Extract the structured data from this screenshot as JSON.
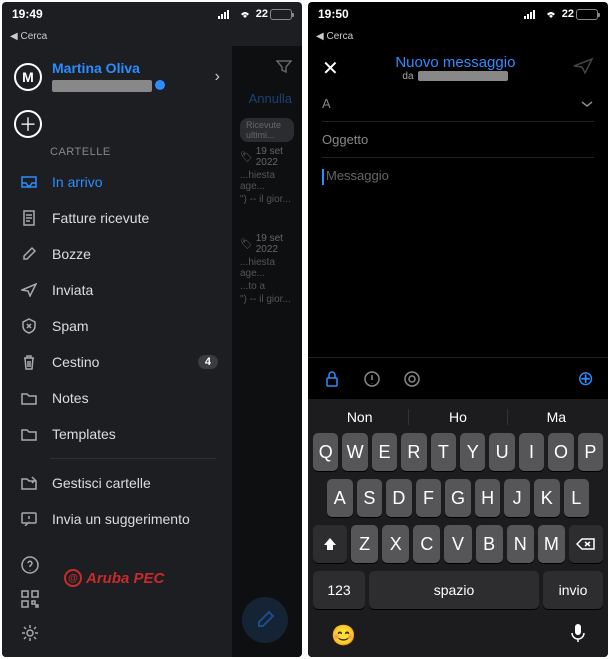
{
  "left": {
    "status": {
      "time": "19:49",
      "search": "Cerca",
      "battery_pct": "22",
      "battery_fill": 22
    },
    "user": {
      "initial": "M",
      "name": "Martina Oliva"
    },
    "section_label": "CARTELLE",
    "folders": [
      {
        "icon": "inbox",
        "label": "In arrivo",
        "active": true
      },
      {
        "icon": "receipt",
        "label": "Fatture ricevute"
      },
      {
        "icon": "draft",
        "label": "Bozze"
      },
      {
        "icon": "sent",
        "label": "Inviata"
      },
      {
        "icon": "spam",
        "label": "Spam"
      },
      {
        "icon": "trash",
        "label": "Cestino",
        "badge": "4"
      },
      {
        "icon": "folder",
        "label": "Notes"
      },
      {
        "icon": "folder",
        "label": "Templates"
      }
    ],
    "manage": {
      "icon": "folder-edit",
      "label": "Gestisci cartelle"
    },
    "feedback": {
      "icon": "feedback",
      "label": "Invia un suggerimento"
    },
    "logo": "Aruba PEC",
    "peek": {
      "cancel": "Annulla",
      "pill": "Ricevute ultimi...",
      "date1": "19 set 2022",
      "subj1": "...hiesta age...",
      "line1": "\") -- il gior...",
      "date2": "19 set 2022",
      "subj2": "...hiesta age...",
      "line2a": "...to a",
      "line2b": "\") -- il gior..."
    }
  },
  "right": {
    "status": {
      "time": "19:50",
      "search": "Cerca",
      "battery_pct": "22",
      "battery_fill": 22
    },
    "compose": {
      "title": "Nuovo messaggio",
      "from_label": "da",
      "to_label": "A",
      "subject_label": "Oggetto",
      "body_placeholder": "Messaggio"
    },
    "keyboard": {
      "suggestions": [
        "Non",
        "Ho",
        "Ma"
      ],
      "row1": [
        "Q",
        "W",
        "E",
        "R",
        "T",
        "Y",
        "U",
        "I",
        "O",
        "P"
      ],
      "row2": [
        "A",
        "S",
        "D",
        "F",
        "G",
        "H",
        "J",
        "K",
        "L"
      ],
      "row3": [
        "Z",
        "X",
        "C",
        "V",
        "B",
        "N",
        "M"
      ],
      "numkey": "123",
      "space": "spazio",
      "enter": "invio"
    }
  }
}
